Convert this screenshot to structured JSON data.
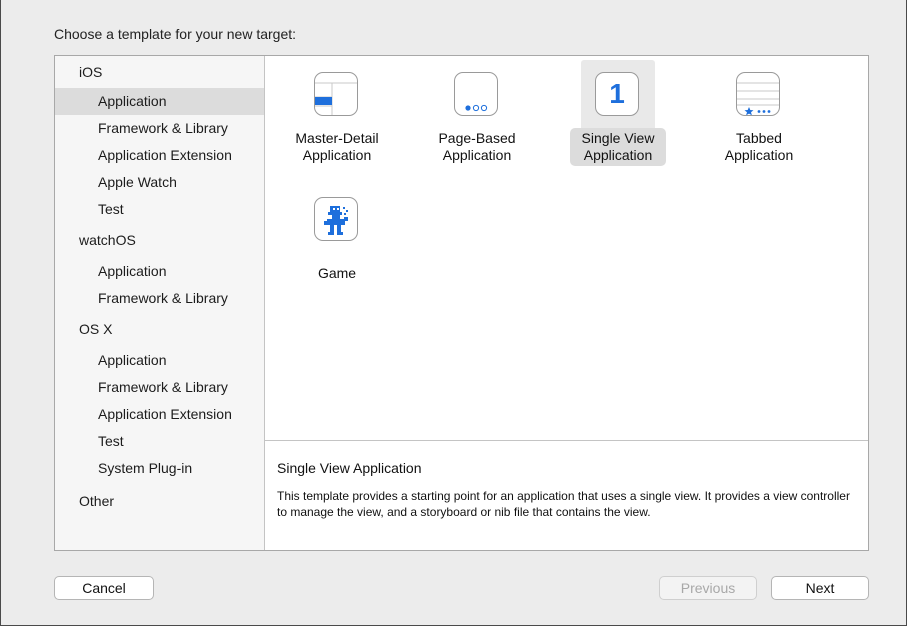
{
  "dialog": {
    "title": "Choose a template for your new target:"
  },
  "sidebar": {
    "groups": [
      {
        "label": "iOS",
        "items": [
          "Application",
          "Framework & Library",
          "Application Extension",
          "Apple Watch",
          "Test"
        ]
      },
      {
        "label": "watchOS",
        "items": [
          "Application",
          "Framework & Library"
        ]
      },
      {
        "label": "OS X",
        "items": [
          "Application",
          "Framework & Library",
          "Application Extension",
          "Test",
          "System Plug-in"
        ]
      },
      {
        "label": "Other",
        "items": []
      }
    ],
    "selected": "iOS / Application"
  },
  "templates": [
    {
      "line1": "Master-Detail",
      "line2": "Application",
      "icon": "master-detail-icon"
    },
    {
      "line1": "Page-Based",
      "line2": "Application",
      "icon": "page-based-icon"
    },
    {
      "line1": "Single View",
      "line2": "Application",
      "icon": "single-view-icon",
      "icon_text": "1",
      "selected": true
    },
    {
      "line1": "Tabbed",
      "line2": "Application",
      "icon": "tabbed-icon"
    },
    {
      "line1": "Game",
      "line2": "",
      "icon": "game-icon"
    }
  ],
  "description": {
    "title": "Single View Application",
    "body": "This template provides a starting point for an application that uses a single view. It provides a view controller to manage the view, and a storyboard or nib file that contains the view."
  },
  "buttons": {
    "cancel": "Cancel",
    "previous": "Previous",
    "next": "Next"
  },
  "colors": {
    "accent": "#1e6fdc",
    "selection": "#dcdcdc"
  }
}
